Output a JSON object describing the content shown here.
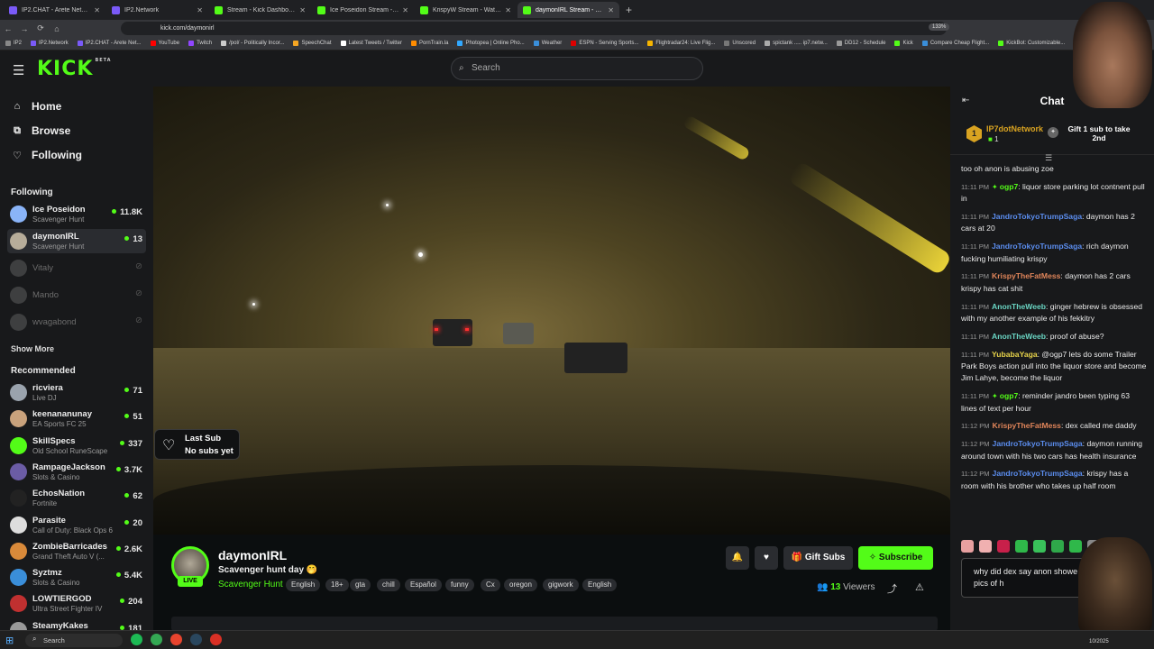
{
  "browser": {
    "tabs": [
      {
        "label": "IP2.CHAT - Arete Network",
        "color": "#7a5af8",
        "active": false
      },
      {
        "label": "IP2.Network",
        "color": "#7a5af8",
        "active": false
      },
      {
        "label": "Stream - Kick Dashboard",
        "color": "#53fc18",
        "active": false
      },
      {
        "label": "Ice Poseidon Stream - Watch Live",
        "color": "#53fc18",
        "active": false
      },
      {
        "label": "KrispyW Stream - Watch Live",
        "color": "#53fc18",
        "active": false
      },
      {
        "label": "daymonIRL Stream - Watch Live",
        "color": "#53fc18",
        "active": true
      }
    ],
    "url": "kick.com/daymonirl",
    "zoom": "133%",
    "bookmarks": [
      "IP2",
      "IP2.Network",
      "IP2.CHAT - Arete Net...",
      "YouTube",
      "Twitch",
      "/pol/ - Politically Incor...",
      "SpeechChat",
      "Latest Tweets / Twitter",
      "PornTrain.la",
      "Photopea | Online Pho...",
      "Weather",
      "ESPN - Serving Sports...",
      "Flightradar24: Live Flig...",
      "Unscored",
      "spictank ..... ip7.netw...",
      "DD12 - Schedule",
      "Kick",
      "Compare Cheap Flight...",
      "KickBot: Customizable..."
    ]
  },
  "header": {
    "logo": "KICK",
    "logo_badge": "BETA",
    "search_placeholder": "Search"
  },
  "sidebar": {
    "nav": [
      {
        "label": "Home",
        "icon": "home-icon"
      },
      {
        "label": "Browse",
        "icon": "browse-icon"
      },
      {
        "label": "Following",
        "icon": "heart-icon"
      }
    ],
    "following_heading": "Following",
    "following": [
      {
        "name": "Ice Poseidon",
        "category": "Scavenger Hunt",
        "viewers": "11.8K",
        "live": true,
        "color": "#8ab4f8"
      },
      {
        "name": "daymonIRL",
        "category": "Scavenger Hunt",
        "viewers": "13",
        "live": true,
        "color": "#b7ad9a",
        "selected": true
      },
      {
        "name": "Vitaly",
        "category": "",
        "viewers": "⊘",
        "live": false,
        "color": "#888"
      },
      {
        "name": "Mando",
        "category": "",
        "viewers": "⊘",
        "live": false,
        "color": "#888"
      },
      {
        "name": "wvagabond",
        "category": "",
        "viewers": "⊘",
        "live": false,
        "color": "#888"
      }
    ],
    "show_more": "Show More",
    "recommended_heading": "Recommended",
    "recommended": [
      {
        "name": "ricviera",
        "category": "Live DJ",
        "viewers": "71",
        "color": "#9aa3ad"
      },
      {
        "name": "keenananunay",
        "category": "EA Sports FC 25",
        "viewers": "51",
        "color": "#c9a27c"
      },
      {
        "name": "SkillSpecs",
        "category": "Old School RuneScape",
        "viewers": "337",
        "color": "#53fc18"
      },
      {
        "name": "RampageJackson",
        "category": "Slots & Casino",
        "viewers": "3.7K",
        "color": "#6b5ca5"
      },
      {
        "name": "EchosNation",
        "category": "Fortnite",
        "viewers": "62",
        "color": "#222"
      },
      {
        "name": "Parasite",
        "category": "Call of Duty: Black Ops 6",
        "viewers": "20",
        "color": "#ddd"
      },
      {
        "name": "ZombieBarricades",
        "category": "Grand Theft Auto V (...",
        "viewers": "2.6K",
        "color": "#d98a3a"
      },
      {
        "name": "Syztmz",
        "category": "Slots & Casino",
        "viewers": "5.4K",
        "color": "#3a8ed9"
      },
      {
        "name": "LOWTIERGOD",
        "category": "Ultra Street Fighter IV",
        "viewers": "204",
        "color": "#c03030"
      },
      {
        "name": "SteamyKakes",
        "category": "",
        "viewers": "181",
        "color": "#999"
      }
    ]
  },
  "player": {
    "last_sub_label": "Last Sub",
    "last_sub_value": "No subs yet"
  },
  "stream": {
    "streamer": "daymonIRL",
    "live_badge": "LIVE",
    "title": "Scavenger hunt day 🤭",
    "category": "Scavenger Hunt",
    "tags": [
      "English",
      "18+",
      "gta",
      "chill",
      "Español",
      "funny",
      "Cx",
      "oregon",
      "gigwork",
      "English"
    ],
    "gift_label": "Gift Subs",
    "subscribe_label": "Subscribe",
    "viewers_count": "13",
    "viewers_label": "Viewers"
  },
  "chat": {
    "title": "Chat",
    "pinned": {
      "rank": "1",
      "name": "IP7dotNetwork",
      "count": "1",
      "gift_text": "Gift 1 sub to take 2nd"
    },
    "messages": [
      {
        "time": "",
        "user": "",
        "color": "#ffffff",
        "badge": "",
        "text": "too oh anon is abusing zoe"
      },
      {
        "time": "11:11 PM",
        "user": "ogp7",
        "color": "#53fc18",
        "badge": "✦",
        "text": "liquor store parking lot contnent pull in"
      },
      {
        "time": "11:11 PM",
        "user": "JandroTokyoTrumpSaga",
        "color": "#5b8def",
        "badge": "",
        "text": "daymon has 2 cars at 20"
      },
      {
        "time": "11:11 PM",
        "user": "JandroTokyoTrumpSaga",
        "color": "#5b8def",
        "badge": "",
        "text": "rich daymon fucking humiliating krispy"
      },
      {
        "time": "11:11 PM",
        "user": "KrispyTheFatMess",
        "color": "#e0855a",
        "badge": "",
        "text": "daymon has 2 cars krispy has cat shit"
      },
      {
        "time": "11:11 PM",
        "user": "AnonTheWeeb",
        "color": "#6ad5c3",
        "badge": "",
        "text": "ginger hebrew is obsessed with my another example of his fekkitry"
      },
      {
        "time": "11:11 PM",
        "user": "AnonTheWeeb",
        "color": "#6ad5c3",
        "badge": "",
        "text": "proof of abuse?"
      },
      {
        "time": "11:11 PM",
        "user": "YubabaYaga",
        "color": "#e6d24a",
        "badge": "",
        "text": "@ogp7 lets do some Trailer Park Boys action pull into the liquor store and become Jim Lahye, become the liquor"
      },
      {
        "time": "11:11 PM",
        "user": "ogp7",
        "color": "#53fc18",
        "badge": "✦",
        "text": "reminder jandro been typing 63 lines of text per hour"
      },
      {
        "time": "11:12 PM",
        "user": "KrispyTheFatMess",
        "color": "#e0855a",
        "badge": "",
        "text": "dex called me daddy"
      },
      {
        "time": "11:12 PM",
        "user": "JandroTokyoTrumpSaga",
        "color": "#5b8def",
        "badge": "",
        "text": "daymon running around town with his two cars has health insurance"
      },
      {
        "time": "11:12 PM",
        "user": "JandroTokyoTrumpSaga",
        "color": "#5b8def",
        "badge": "",
        "text": "krispy has a room with his brother who takes up half room"
      }
    ],
    "emote_colors": [
      "#e8a0a0",
      "#f0b0b0",
      "#c8204a",
      "#2fb84a",
      "#39c15a",
      "#2fa84a",
      "#2fb84a",
      "#888",
      "#2fb84a"
    ],
    "input_text": "why did dex say anon showe pics of h"
  },
  "taskbar": {
    "search_label": "Search",
    "date": "10/2025"
  }
}
